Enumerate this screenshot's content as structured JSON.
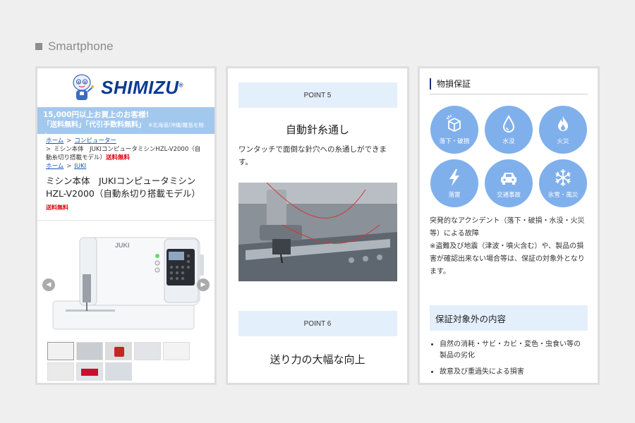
{
  "section": {
    "label": "Smartphone"
  },
  "panel1": {
    "brand": "HIMIZU",
    "brand_initial": "S",
    "brand_mark": "®",
    "banner": {
      "line1": "15,000円以上お買上のお客様!",
      "line2": "「送料無料」「代引手数料無料」",
      "note": "※北海道/沖縄/離島を除く"
    },
    "breadcrumb": {
      "home1": "ホーム",
      "category": "コンピューター",
      "sep": ">",
      "product_path": "ミシン本体　JUKIコンピュータミシンHZL-V2000（自動糸切り搭載モデル）",
      "free_tag": "送料無料",
      "home2": "ホーム",
      "brand": "JUKI"
    },
    "title": "ミシン本体　JUKIコンピュータミシンHZL-V2000（自動糸切り搭載モデル）",
    "free_tag": "送料無料",
    "gallery": {
      "prev": "◀",
      "next": "▶",
      "thumbs": 7
    },
    "machine_brand": "JUKI"
  },
  "panel2": {
    "point5": {
      "label": "POINT 5",
      "title": "自動針糸通し",
      "desc": "ワンタッチで面倒な針穴への糸通しができます。"
    },
    "point6": {
      "label": "POINT 6",
      "title": "送り力の大幅な向上"
    }
  },
  "panel3": {
    "heading": "物損保証",
    "icons": [
      {
        "name": "drop-damage",
        "label": "落下・破損"
      },
      {
        "name": "water",
        "label": "水没"
      },
      {
        "name": "fire",
        "label": "火災"
      },
      {
        "name": "lightning",
        "label": "落雷"
      },
      {
        "name": "car",
        "label": "交通事故"
      },
      {
        "name": "snow",
        "label": "氷雪・風災"
      }
    ],
    "text1": "突発的なアクシデント（落下・破損・水没・火災等）による故障",
    "text2": "※盗難及び地震（津波・噴火含む）や、製品の損害が確認出来ない場合等は、保証の対象外となります。",
    "excluded_heading": "保証対象外の内容",
    "excluded": [
      "自然の消耗・サビ・カビ・変色・虫食い等の製品の劣化",
      "故意及び重過失による損害"
    ]
  }
}
